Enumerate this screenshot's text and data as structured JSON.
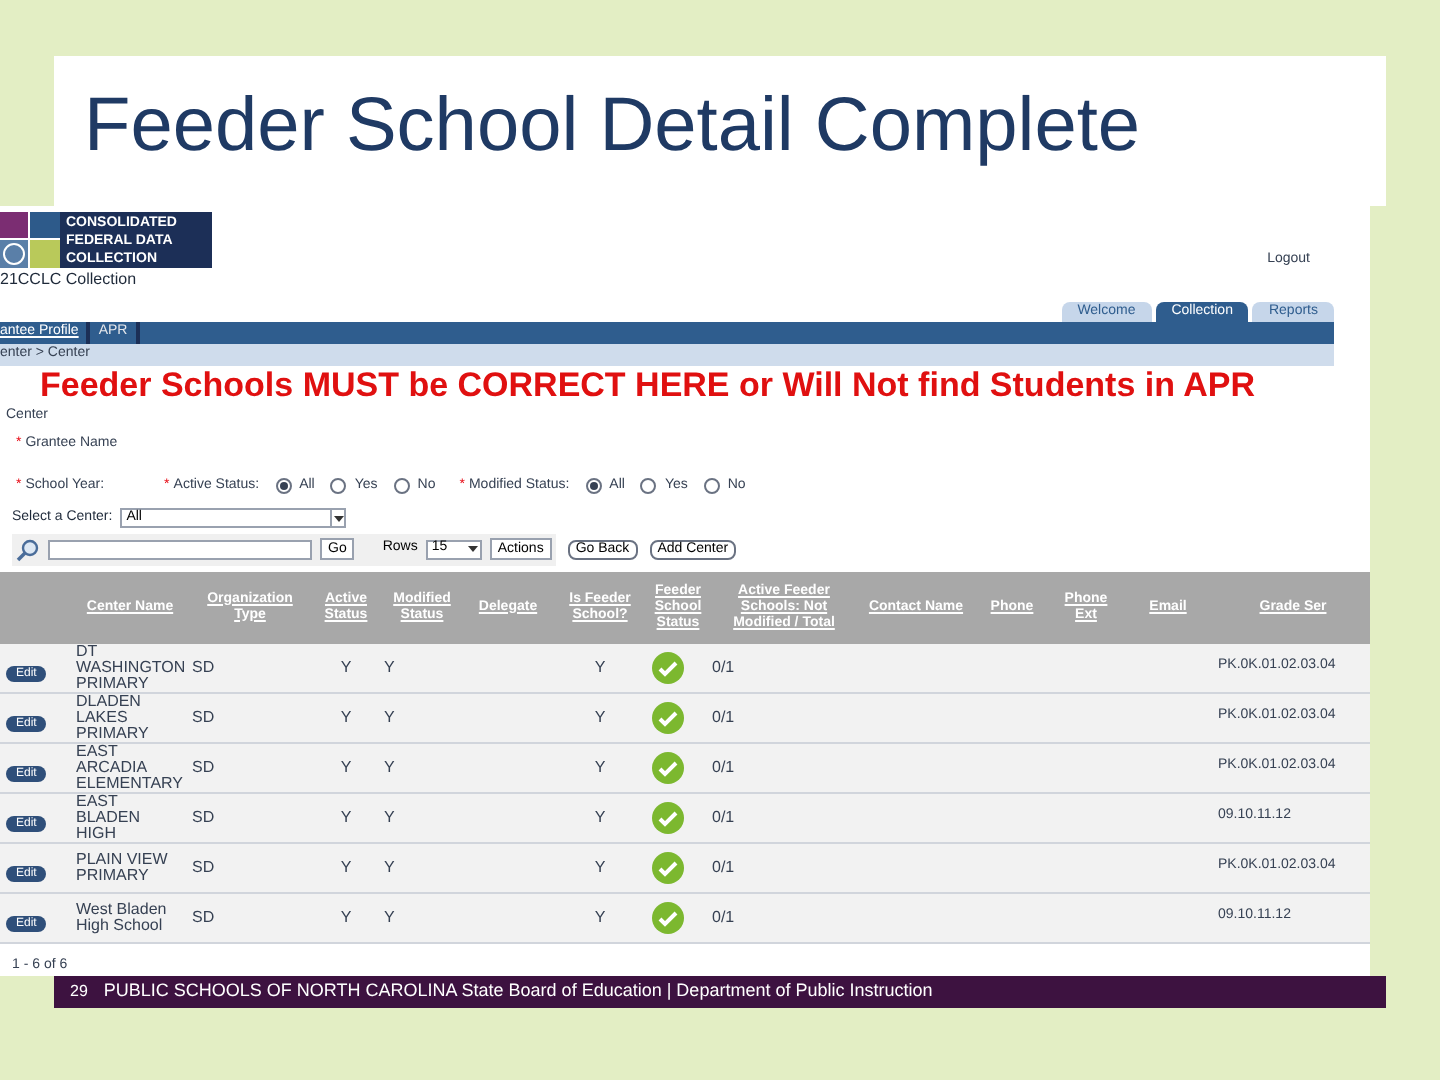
{
  "slide": {
    "title": "Feeder School Detail Complete",
    "page_number": "29",
    "footer": "PUBLIC SCHOOLS OF NORTH CAROLINA State Board of Education | Department of Public Instruction"
  },
  "app": {
    "logo_lines": [
      "CONSOLIDATED",
      "FEDERAL DATA",
      "COLLECTION"
    ],
    "collection_label": "21CCLC Collection",
    "logout": "Logout",
    "tabs": [
      {
        "label": "Welcome",
        "selected": false
      },
      {
        "label": "Collection",
        "selected": true
      },
      {
        "label": "Reports",
        "selected": false
      }
    ],
    "nav_links": [
      {
        "label": "antee Profile",
        "selected": true
      },
      {
        "label": "APR",
        "selected": false
      }
    ],
    "breadcrumb": "enter > Center",
    "banner": "Feeder Schools MUST be CORRECT HERE or Will Not find Students in APR",
    "section_title": "Center",
    "grantee_name": {
      "required_mark": "*",
      "label": "Grantee Name"
    },
    "school_year": {
      "required_mark": "*",
      "label": "School Year:"
    },
    "active_status": {
      "required_mark": "*",
      "label": "Active Status:",
      "options": [
        {
          "label": "All",
          "selected": true
        },
        {
          "label": "Yes",
          "selected": false
        },
        {
          "label": "No",
          "selected": false
        }
      ]
    },
    "modified_status": {
      "required_mark": "*",
      "label": "Modified Status:",
      "options": [
        {
          "label": "All",
          "selected": true
        },
        {
          "label": "Yes",
          "selected": false
        },
        {
          "label": "No",
          "selected": false
        }
      ]
    },
    "center_select": {
      "label": "Select a Center:",
      "value": "All"
    },
    "toolbar": {
      "go": "Go",
      "rows_label": "Rows",
      "rows_value": "15",
      "actions": "Actions",
      "go_back": "Go Back",
      "add_center": "Add Center"
    },
    "table": {
      "columns": [
        "Center Name",
        "Organization Type",
        "Active Status",
        "Modified Status",
        "Delegate",
        "Is Feeder School?",
        "Feeder School Status",
        "Active Feeder Schools: Not Modified / Total",
        "Contact Name",
        "Phone",
        "Phone Ext",
        "Email",
        "Grade Ser"
      ],
      "rows": [
        {
          "action": "Edit",
          "center_name": "DT WASHINGTON PRIMARY",
          "org_type": "SD",
          "active": "Y",
          "modified": "Y",
          "is_feeder": "Y",
          "feeder_complete": true,
          "feeder_count": "0/1",
          "grade": "PK.0K.01.02.03.04"
        },
        {
          "action": "Edit",
          "center_name": "DLADEN LAKES PRIMARY",
          "org_type": "SD",
          "active": "Y",
          "modified": "Y",
          "is_feeder": "Y",
          "feeder_complete": true,
          "feeder_count": "0/1",
          "grade": "PK.0K.01.02.03.04"
        },
        {
          "action": "Edit",
          "center_name": "EAST ARCADIA ELEMENTARY",
          "org_type": "SD",
          "active": "Y",
          "modified": "Y",
          "is_feeder": "Y",
          "feeder_complete": true,
          "feeder_count": "0/1",
          "grade": "PK.0K.01.02.03.04"
        },
        {
          "action": "Edit",
          "center_name": "EAST BLADEN HIGH",
          "org_type": "SD",
          "active": "Y",
          "modified": "Y",
          "is_feeder": "Y",
          "feeder_complete": true,
          "feeder_count": "0/1",
          "grade": "09.10.11.12"
        },
        {
          "action": "Edit",
          "center_name": "PLAIN VIEW PRIMARY",
          "org_type": "SD",
          "active": "Y",
          "modified": "Y",
          "is_feeder": "Y",
          "feeder_complete": true,
          "feeder_count": "0/1",
          "grade": "PK.0K.01.02.03.04"
        },
        {
          "action": "Edit",
          "center_name": "West Bladen High School",
          "org_type": "SD",
          "active": "Y",
          "modified": "Y",
          "is_feeder": "Y",
          "feeder_complete": true,
          "feeder_count": "0/1",
          "grade": "09.10.11.12"
        }
      ],
      "pagination": "1 - 6 of 6"
    }
  }
}
